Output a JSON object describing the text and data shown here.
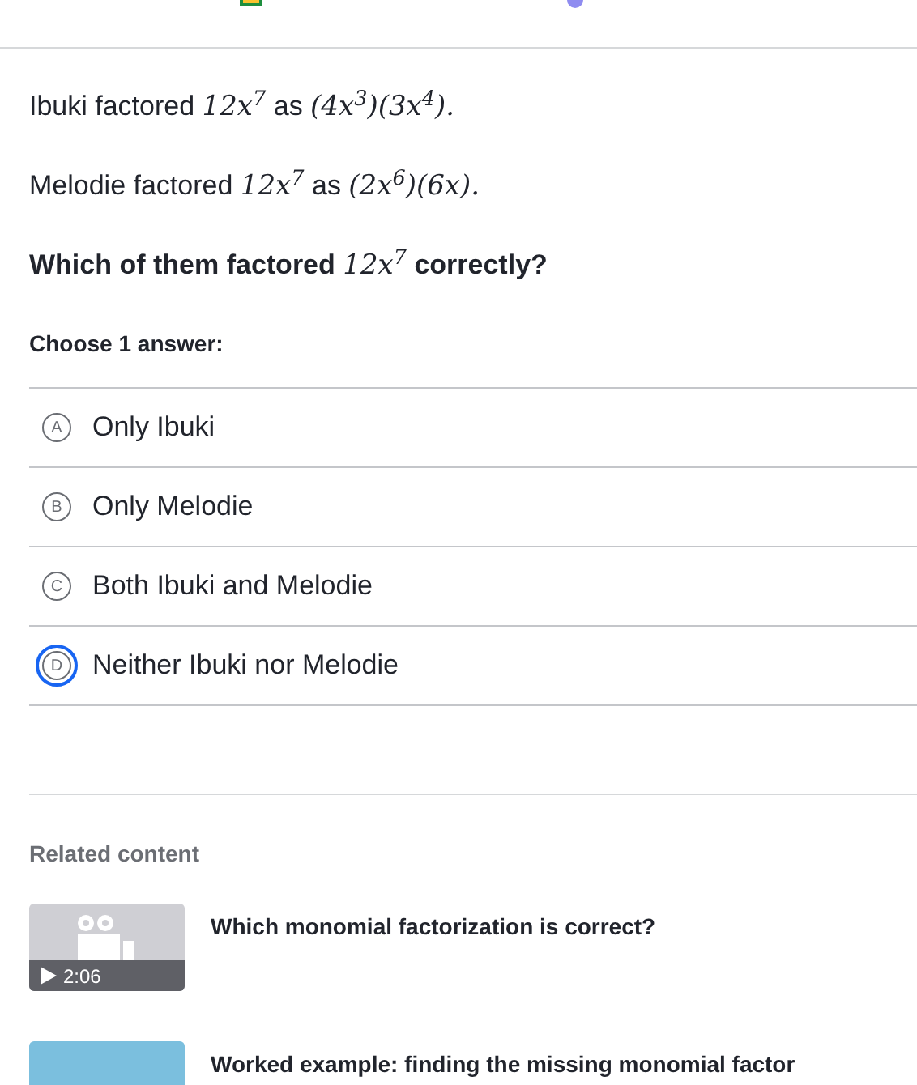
{
  "question": {
    "paragraphs": [
      {
        "bold": false,
        "segments": [
          {
            "kind": "text",
            "text": "Ibuki factored "
          },
          {
            "kind": "math",
            "text": "12x$^{7}$"
          },
          {
            "kind": "text",
            "text": " as "
          },
          {
            "kind": "math",
            "text": "(4x$^{3}$)(3x$^{4}$)."
          }
        ]
      },
      {
        "bold": false,
        "segments": [
          {
            "kind": "text",
            "text": "Melodie factored "
          },
          {
            "kind": "math",
            "text": "12x$^{7}$"
          },
          {
            "kind": "text",
            "text": " as "
          },
          {
            "kind": "math",
            "text": "(2x$^{6}$)(6x)."
          }
        ]
      },
      {
        "bold": true,
        "segments": [
          {
            "kind": "text",
            "text": "Which of them factored "
          },
          {
            "kind": "math",
            "text": "12x$^{7}$"
          },
          {
            "kind": "text",
            "text": " correctly?"
          }
        ]
      }
    ],
    "instruction": "Choose 1 answer:",
    "choices": [
      {
        "letter": "A",
        "label": "Only Ibuki",
        "selected": false
      },
      {
        "letter": "B",
        "label": "Only Melodie",
        "selected": false
      },
      {
        "letter": "C",
        "label": "Both Ibuki and Melodie",
        "selected": false
      },
      {
        "letter": "D",
        "label": "Neither Ibuki nor Melodie",
        "selected": true
      }
    ]
  },
  "related": {
    "heading": "Related content",
    "items": [
      {
        "kind": "video",
        "duration": "2:06",
        "title": "Which monomial factorization is correct?"
      },
      {
        "kind": "plain",
        "title": "Worked example: finding the missing monomial factor"
      }
    ]
  }
}
